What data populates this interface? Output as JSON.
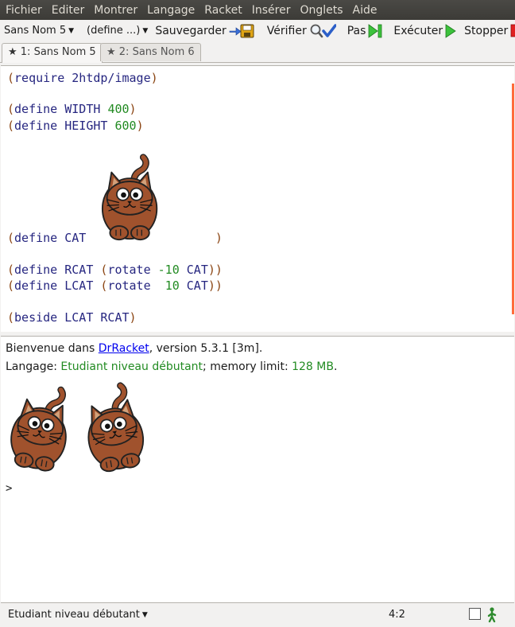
{
  "menu": [
    "Fichier",
    "Editer",
    "Montrer",
    "Langage",
    "Racket",
    "Insérer",
    "Onglets",
    "Aide"
  ],
  "toolbar": {
    "file_dropdown": "Sans Nom 5",
    "define_dropdown": "(define ...)",
    "save_label": "Sauvegarder",
    "check_label": "Vérifier",
    "step_label": "Pas",
    "run_label": "Exécuter",
    "stop_label": "Stopper"
  },
  "tabs": [
    {
      "label": "★ 1: Sans Nom 5",
      "active": true
    },
    {
      "label": "★ 2: Sans Nom 6",
      "active": false
    }
  ],
  "editor": {
    "require": {
      "kw": "require",
      "arg": "2htdp/image"
    },
    "width": {
      "kw": "define",
      "name": "WIDTH",
      "value": "400"
    },
    "height": {
      "kw": "define",
      "name": "HEIGHT",
      "value": "600"
    },
    "cat": {
      "kw": "define",
      "name": "CAT"
    },
    "rcat": {
      "kw": "define",
      "name": "RCAT",
      "fn": "rotate",
      "value": "-10",
      "arg": "CAT"
    },
    "lcat": {
      "kw": "define",
      "name": "LCAT",
      "fn": "rotate",
      "value": "10",
      "arg": "CAT"
    },
    "beside": {
      "fn": "beside",
      "args": "LCAT RCAT"
    }
  },
  "interactions": {
    "welcome_prefix": "Bienvenue dans ",
    "welcome_link": "DrRacket",
    "welcome_suffix": ", version 5.3.1 [3m].",
    "lang_prefix": "Langage: ",
    "lang_name": "Etudiant niveau débutant",
    "lang_mid": "; memory limit: ",
    "memory": "128 MB",
    "lang_end": ".",
    "prompt": ">"
  },
  "status": {
    "language": "Etudiant niveau débutant",
    "position": "4:2"
  },
  "colors": {
    "paren": "#8b4513",
    "keyword": "#262680",
    "number": "#228b22",
    "cat_fur": "#a0522d"
  }
}
